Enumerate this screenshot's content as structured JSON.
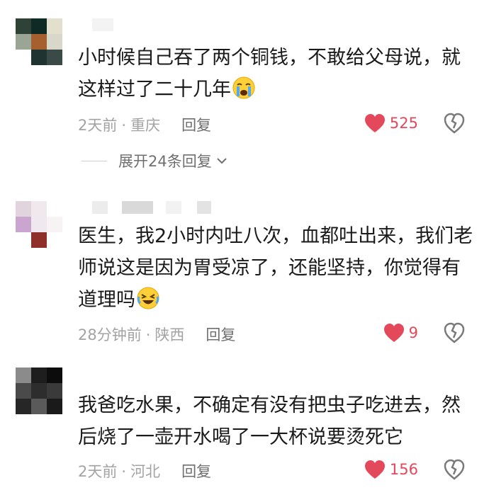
{
  "comments": [
    {
      "text": "小时候自己吞了两个铜钱，不敢给父母说，就这样过了二十几年",
      "emoji": "crying-face",
      "time": "2天前",
      "location": "重庆",
      "reply_label": "回复",
      "likes": "525"
    },
    {
      "text": "医生，我2小时内吐八次，血都吐出来，我们老师说这是因为胃受凉了，还能坚持，你觉得有道理吗",
      "emoji": "rolling-laughing-face",
      "time": "28分钟前",
      "location": "陕西",
      "reply_label": "回复",
      "likes": "9"
    },
    {
      "text": "我爸吃水果，不确定有没有把虫子吃进去，然后烧了一壶开水喝了一大杯说要烫死它",
      "emoji": "",
      "time": "2天前",
      "location": "河北",
      "reply_label": "回复",
      "likes": "156"
    }
  ],
  "expand_replies_label": "展开24条回复",
  "dot": "·",
  "colors": {
    "like_red": "#e4485b",
    "muted": "#a3a3a3",
    "reply": "#6f6f6f"
  }
}
